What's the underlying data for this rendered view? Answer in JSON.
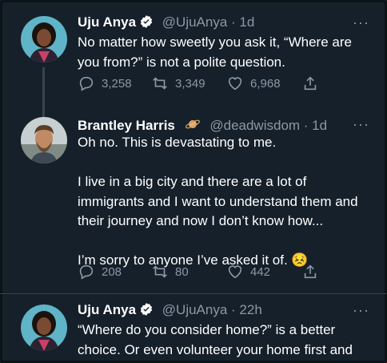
{
  "tweets": [
    {
      "name": "Uju Anya",
      "handle": "@UjuAnya",
      "time": "· 1d",
      "lines": [
        "No matter how sweetly you ask it, “Where are",
        "you from?” is not a polite question."
      ],
      "replies": "3,258",
      "retweets": "3,349",
      "likes": "6,968"
    },
    {
      "name": "Brantley Harris",
      "handle": "@deadwisdom",
      "time": "· 1d",
      "lines": [
        "Oh no. This is devastating to me.",
        "",
        "I live in a big city and there are a lot of",
        "immigrants and I want to understand them and",
        "their journey and now I don’t know how...",
        "",
        "I’m sorry to anyone I’ve asked it of. 😣"
      ],
      "replies": "208",
      "retweets": "80",
      "likes": "442"
    },
    {
      "name": "Uju Anya",
      "handle": "@UjuAnya",
      "time": "· 22h",
      "lines": [
        "“Where do you consider home?” is a better",
        "choice. Or even volunteer your home first and"
      ]
    }
  ],
  "more_label": "···",
  "colors": {
    "background": "#15202b",
    "text": "#ffffff",
    "muted": "#8b98a5",
    "verified": "#ffffff"
  }
}
